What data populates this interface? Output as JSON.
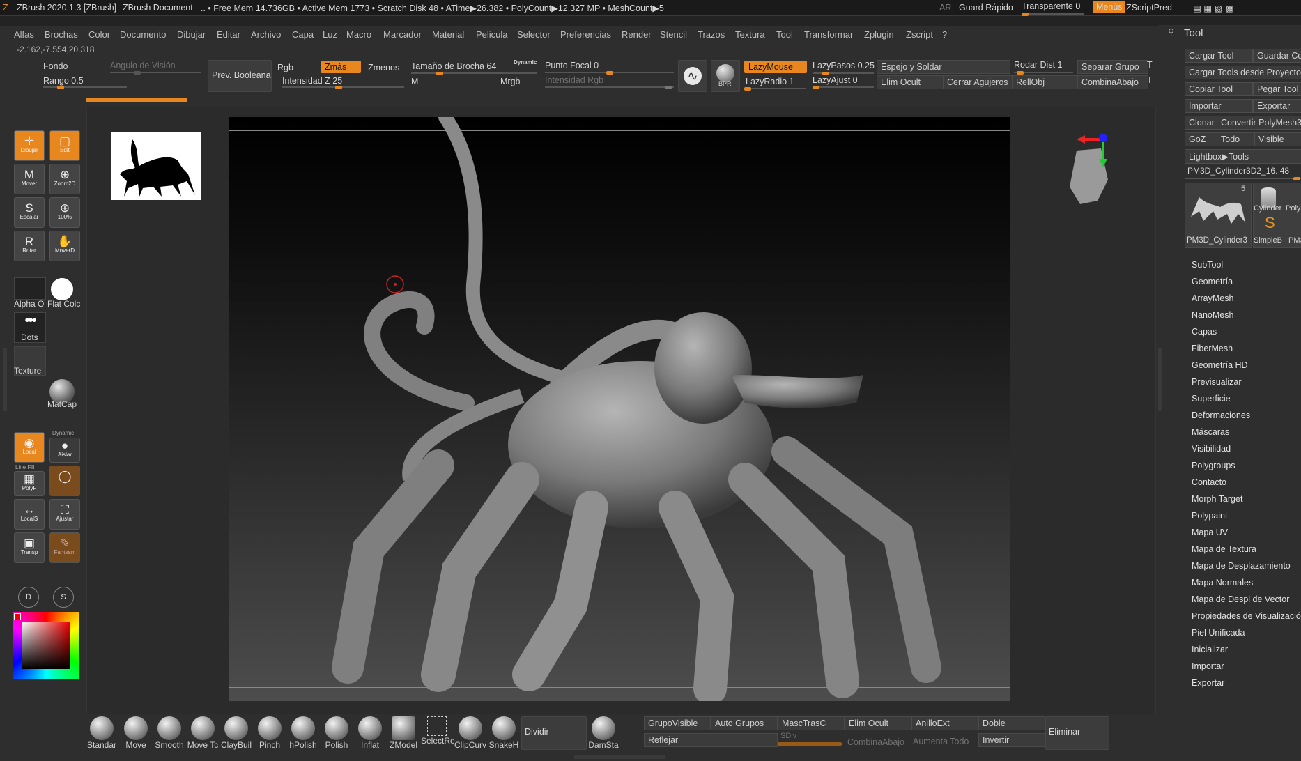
{
  "titlebar": {
    "app": "ZBrush 2020.1.3 [ZBrush]",
    "doc": "ZBrush Document",
    "stats": ".. • Free Mem 14.736GB • Active Mem 1773 • Scratch Disk 48 • ATime▶26.382 • PolyCount▶12.327 MP • MeshCount▶5",
    "ar": "AR",
    "quick_save": "Guard Rápido",
    "transparent": "Transparente 0",
    "menus": "Menús",
    "zscript": "ZScriptPred"
  },
  "menubar": [
    "Alfas",
    "Brochas",
    "Color",
    "Documento",
    "Dibujar",
    "Editar",
    "Archivo",
    "Capa",
    "Luz",
    "Macro",
    "Marcador",
    "Material",
    "Pelicula",
    "Selector",
    "Preferencias",
    "Render",
    "Stencil",
    "Trazos",
    "Textura",
    "Tool",
    "Transformar",
    "Zplugin",
    "Zscript",
    "?"
  ],
  "coords": "-2.162,-7.554,20.318",
  "topshelf": {
    "fondo": "Fondo",
    "angulo": "Ángulo de Visión",
    "rango": "Rango 0.5",
    "prev_booleana": "Prev. Booleana",
    "rgb": "Rgb",
    "zmas": "Zmás",
    "zmenos": "Zmenos",
    "intensidad_z": "Intensidad Z 25",
    "mrgb": "Mrgb",
    "m": "M",
    "tamano": "Tamaño de Brocha 64",
    "dynamic": "Dynamic",
    "punto_focal": "Punto Focal 0",
    "intensidad_rgb": "Intensidad Rgb",
    "bpr": "BPR",
    "lazymouse": "LazyMouse",
    "lazyradio": "LazyRadio 1",
    "lazypasos": "LazyPasos 0.25",
    "lazyajust": "LazyAjust 0",
    "espejo": "Espejo y Soldar",
    "elim_ocult": "Elim Ocult",
    "cerrar_agujeros": "Cerrar Agujeros",
    "rodar_dist": "Rodar Dist 1",
    "rellobj": "RellObj",
    "separar_grupo": "Separar Grupo",
    "combina_abajo": "CombinaAbajo",
    "t1": "T",
    "t2": "T"
  },
  "lefttools": [
    {
      "label": "Dibujar",
      "icon": "✛",
      "on": true
    },
    {
      "label": "Edit",
      "icon": "▢",
      "on": true
    },
    {
      "label": "Mover",
      "icon": "M",
      "on": false
    },
    {
      "label": "Zoom2D",
      "icon": "⊕",
      "on": false
    },
    {
      "label": "Escalar",
      "icon": "S",
      "on": false
    },
    {
      "label": "100%",
      "icon": "⊕",
      "on": false
    },
    {
      "label": "Rotar",
      "icon": "R",
      "on": false
    },
    {
      "label": "MoverD",
      "icon": "✋",
      "on": false
    }
  ],
  "leftpanel": {
    "alpha": "Alpha O",
    "flat": "Flat Colc",
    "dots": "Dots",
    "texture": "Texture",
    "matcap": "MatCap",
    "local": "Local",
    "aislar": "Aislar",
    "dynamic": "Dynamic",
    "linefill": "Line Fill",
    "polyf": "PolyF",
    "locals": "LocalS",
    "ajustar": "Ajustar",
    "transp": "Transp",
    "fantasm": "Fantasm",
    "d": "D",
    "s": "S"
  },
  "brushes": [
    "Standar",
    "Move",
    "Smooth",
    "Move Tc",
    "ClayBuil",
    "Pinch",
    "hPolish",
    "Polish",
    "Inflat",
    "ZModel",
    "SelectRe",
    "ClipCurv",
    "SnakeH"
  ],
  "bottom": {
    "dividir": "Dividir",
    "damsta": "DamSta",
    "grupovisible": "GrupoVisible",
    "auto_grupos": "Auto Grupos",
    "masctrasc": "MascTrasC",
    "elim_ocult": "Elim Ocult",
    "anilloext": "AnilloExt",
    "doble": "Doble",
    "eliminar": "Eliminar",
    "reflejar": "Reflejar",
    "sdiv": "SDiv",
    "combina_abajo": "CombinaAbajo",
    "aumenta_todo": "Aumenta Todo",
    "invertir": "Invertir"
  },
  "rightpanel": {
    "title": "Tool",
    "buttons": [
      [
        "Cargar Tool",
        "Guardar Co"
      ],
      [
        "Cargar Tools desde Proyecto"
      ],
      [
        "Copiar Tool",
        "Pegar Tool"
      ],
      [
        "Importar",
        "Exportar"
      ],
      [
        "Clonar",
        "Convertir PolyMesh3"
      ],
      [
        "GoZ",
        "Todo",
        "Visible"
      ],
      [
        "Lightbox▶Tools"
      ]
    ],
    "current_tool": "PM3D_Cylinder3D2_16. 48",
    "count": "5",
    "thumb1": "PM3D_Cylinder3",
    "thumb2": "Cylinder",
    "thumb3": "Poly",
    "thumb4": "SimpleB",
    "thumb5": "PM3",
    "sections": [
      "SubTool",
      "Geometría",
      "ArrayMesh",
      "NanoMesh",
      "Capas",
      "FiberMesh",
      "Geometría HD",
      "Previsualizar",
      "Superficie",
      "Deformaciones",
      "Máscaras",
      "Visibilidad",
      "Polygroups",
      "Contacto",
      "Morph Target",
      "Polypaint",
      "Mapa UV",
      "Mapa de Textura",
      "Mapa de Desplazamiento",
      "Mapa Normales",
      "Mapa de Despl de Vector",
      "Propiedades de Visualización",
      "Piel Unificada",
      "Inicializar",
      "Importar",
      "Exportar"
    ]
  },
  "colors": {
    "accent": "#e8871e",
    "bg": "#2e2e2e",
    "canvas_top": "#000000",
    "canvas_bottom": "#4a4a4a"
  }
}
